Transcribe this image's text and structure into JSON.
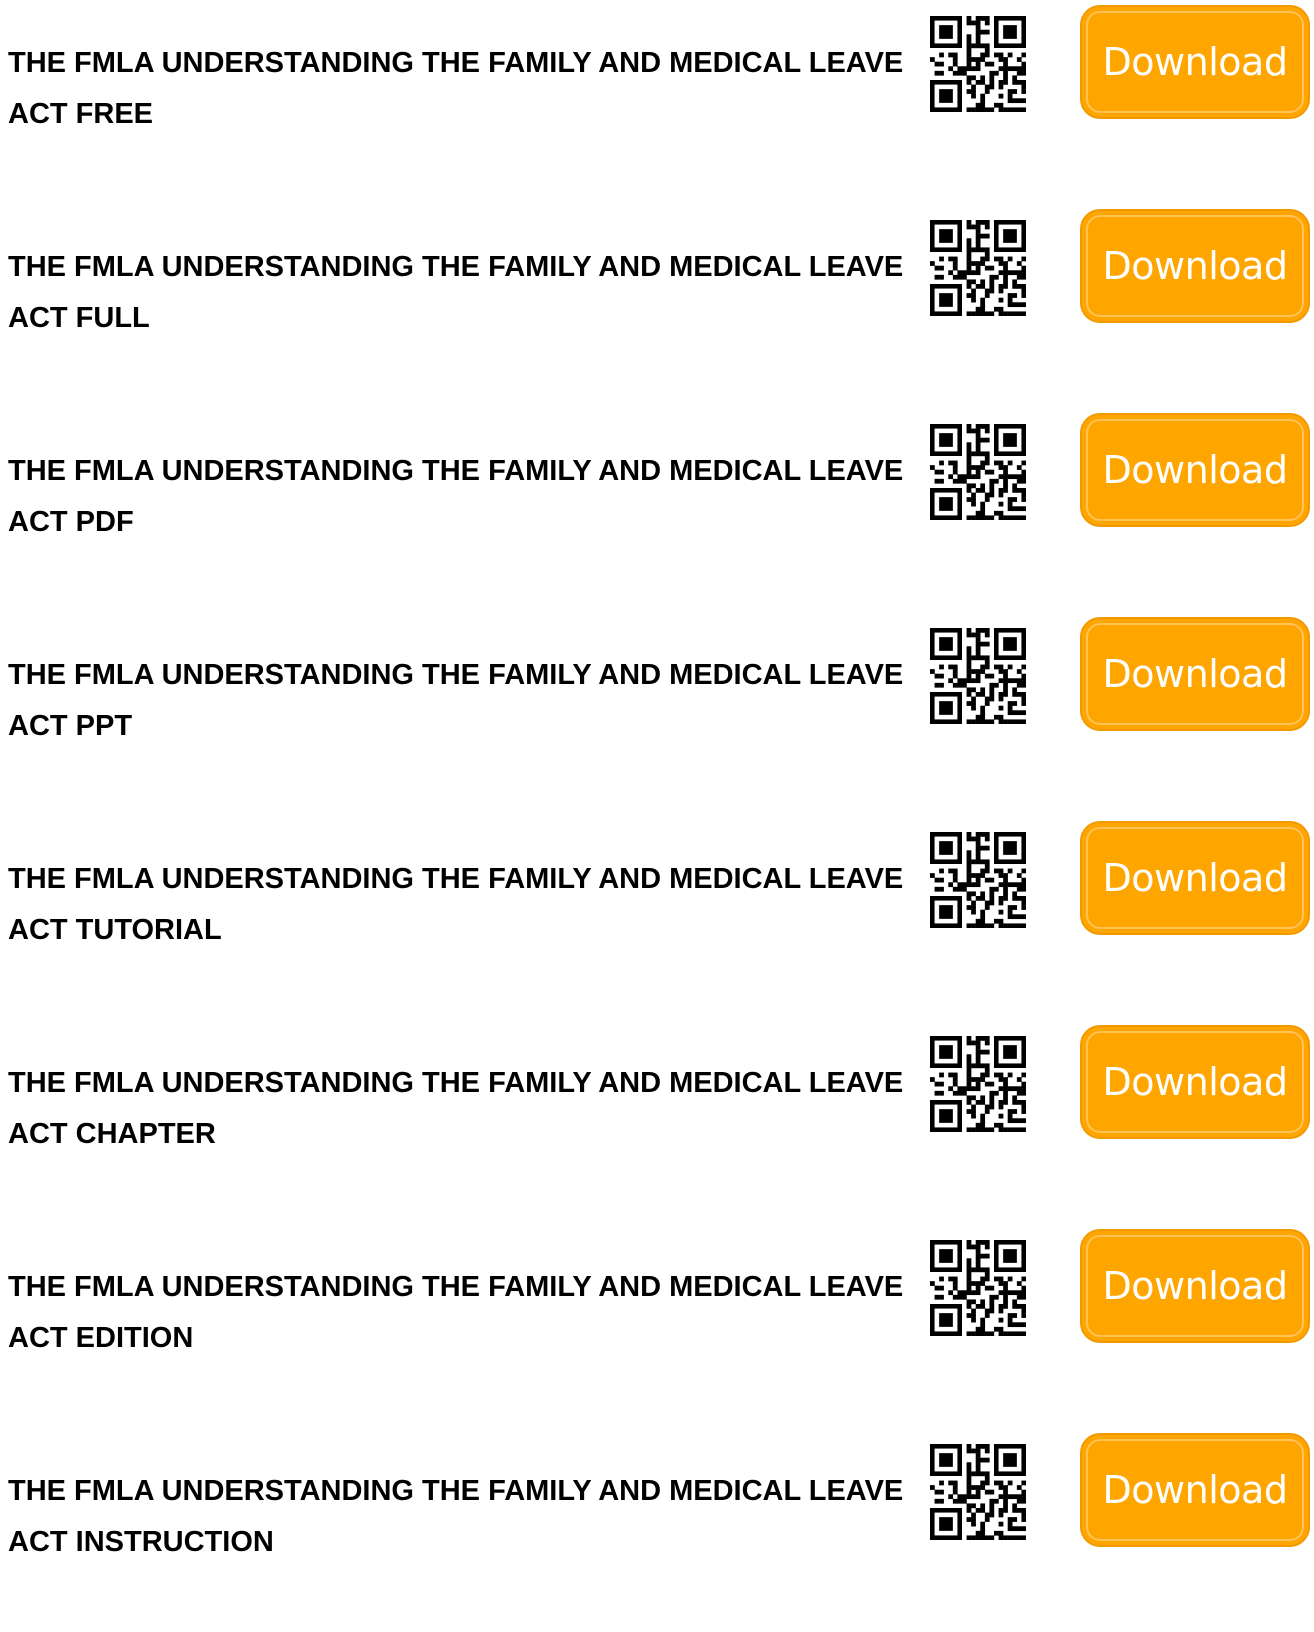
{
  "items": [
    {
      "title": "THE FMLA UNDERSTANDING THE FAMILY AND MEDICAL LEAVE ACT FREE",
      "button_label": "Download"
    },
    {
      "title": "THE FMLA UNDERSTANDING THE FAMILY AND MEDICAL LEAVE ACT FULL",
      "button_label": "Download"
    },
    {
      "title": "THE FMLA UNDERSTANDING THE FAMILY AND MEDICAL LEAVE ACT PDF",
      "button_label": "Download"
    },
    {
      "title": "THE FMLA UNDERSTANDING THE FAMILY AND MEDICAL LEAVE ACT PPT",
      "button_label": "Download"
    },
    {
      "title": "THE FMLA UNDERSTANDING THE FAMILY AND MEDICAL LEAVE ACT TUTORIAL",
      "button_label": "Download"
    },
    {
      "title": "THE FMLA UNDERSTANDING THE FAMILY AND MEDICAL LEAVE ACT CHAPTER",
      "button_label": "Download"
    },
    {
      "title": "THE FMLA UNDERSTANDING THE FAMILY AND MEDICAL LEAVE ACT EDITION",
      "button_label": "Download"
    },
    {
      "title": "THE FMLA UNDERSTANDING THE FAMILY AND MEDICAL LEAVE ACT INSTRUCTION",
      "button_label": "Download"
    }
  ],
  "icons": {
    "qr": "qr-code-icon"
  },
  "colors": {
    "button_bg": "#ffa500",
    "button_text": "#ffffff",
    "title_text": "#000000"
  }
}
